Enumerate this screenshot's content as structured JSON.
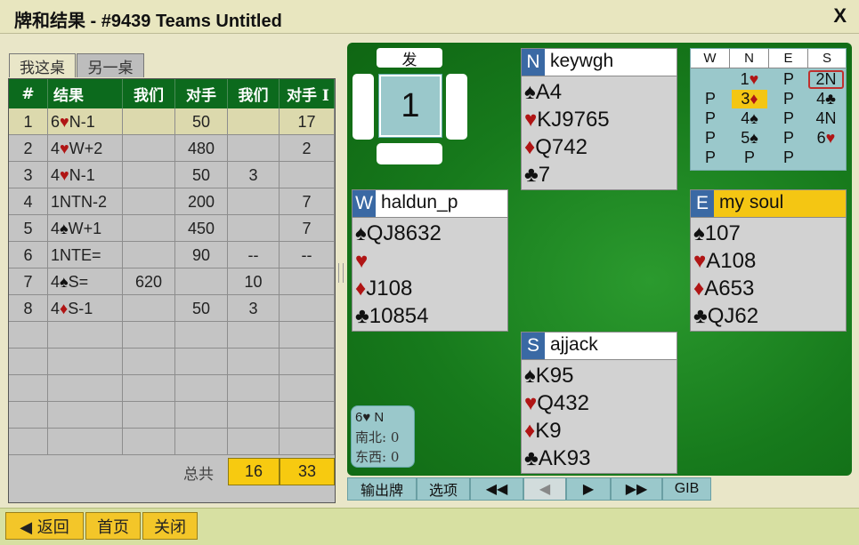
{
  "window": {
    "title": "牌和结果 - #9439 Teams Untitled",
    "close_icon": "X"
  },
  "tabs": [
    "我这桌",
    "另一桌"
  ],
  "results_table": {
    "headers": [
      "#",
      "结果",
      "我们",
      "对手",
      "我们",
      "对手 I"
    ],
    "rows": [
      {
        "n": "1",
        "contract": "6",
        "suit": "♥",
        "suit_color": "red",
        "rest": "N-1",
        "we1": "",
        "op1": "50",
        "we2": "",
        "op2": "17"
      },
      {
        "n": "2",
        "contract": "4",
        "suit": "♥",
        "suit_color": "red",
        "rest": "W+2",
        "we1": "",
        "op1": "480",
        "we2": "",
        "op2": "2"
      },
      {
        "n": "3",
        "contract": "4",
        "suit": "♥",
        "suit_color": "red",
        "rest": "N-1",
        "we1": "",
        "op1": "50",
        "we2": "3",
        "op2": ""
      },
      {
        "n": "4",
        "contract": "1NTN-2",
        "suit": "",
        "suit_color": "",
        "rest": "",
        "we1": "",
        "op1": "200",
        "we2": "",
        "op2": "7"
      },
      {
        "n": "5",
        "contract": "4",
        "suit": "♠",
        "suit_color": "black",
        "rest": "W+1",
        "we1": "",
        "op1": "450",
        "we2": "",
        "op2": "7"
      },
      {
        "n": "6",
        "contract": "1NTE=",
        "suit": "",
        "suit_color": "",
        "rest": "",
        "we1": "",
        "op1": "90",
        "we2": "--",
        "op2": "--"
      },
      {
        "n": "7",
        "contract": "4",
        "suit": "♠",
        "suit_color": "black",
        "rest": "S=",
        "we1": "620",
        "op1": "",
        "we2": "10",
        "op2": ""
      },
      {
        "n": "8",
        "contract": "4",
        "suit": "♦",
        "suit_color": "red",
        "rest": "S-1",
        "we1": "",
        "op1": "50",
        "we2": "3",
        "op2": ""
      }
    ],
    "empty_rows": 5,
    "total_label": "总共",
    "total_we": "16",
    "total_op": "33"
  },
  "board": {
    "dealer_label": "发",
    "number": "1"
  },
  "hands": {
    "north": {
      "dir": "N",
      "name": "keywgh",
      "spades": "A4",
      "hearts": "KJ9765",
      "diamonds": "Q742",
      "clubs": "7"
    },
    "west": {
      "dir": "W",
      "name": "haldun_p",
      "spades": "QJ8632",
      "hearts": "",
      "diamonds": "J108",
      "clubs": "10854"
    },
    "east": {
      "dir": "E",
      "name": "my soul",
      "spades": "107",
      "hearts": "A108",
      "diamonds": "A653",
      "clubs": "QJ62"
    },
    "south": {
      "dir": "S",
      "name": "ajjack",
      "spades": "K95",
      "hearts": "Q432",
      "diamonds": "K9",
      "clubs": "AK93"
    }
  },
  "bidding": {
    "headers": [
      "W",
      "N",
      "E",
      "S"
    ],
    "bids": [
      [
        "",
        "1♥",
        "P",
        "2N"
      ],
      [
        "P",
        "3♦",
        "P",
        "4♣"
      ],
      [
        "P",
        "4♠",
        "P",
        "4N"
      ],
      [
        "P",
        "5♠",
        "P",
        "6♥"
      ],
      [
        "P",
        "P",
        "P",
        ""
      ]
    ]
  },
  "contract_info": {
    "contract": "6♥ N",
    "ns": "南北: 0",
    "ew": "东西: 0"
  },
  "controls": {
    "export": "输出牌",
    "options": "选项",
    "first": "◀◀",
    "prev": "◀",
    "next": "▶",
    "last": "▶▶",
    "gib": "GIB"
  },
  "bottom": {
    "back": "◀ 返回",
    "home": "首页",
    "close": "关闭"
  },
  "colors": {
    "felt": "#177a1c",
    "header_green": "#0c6a1d",
    "accent_yellow": "#f4c613",
    "seat_blue": "#3a69a4",
    "red_suit": "#b01515"
  }
}
